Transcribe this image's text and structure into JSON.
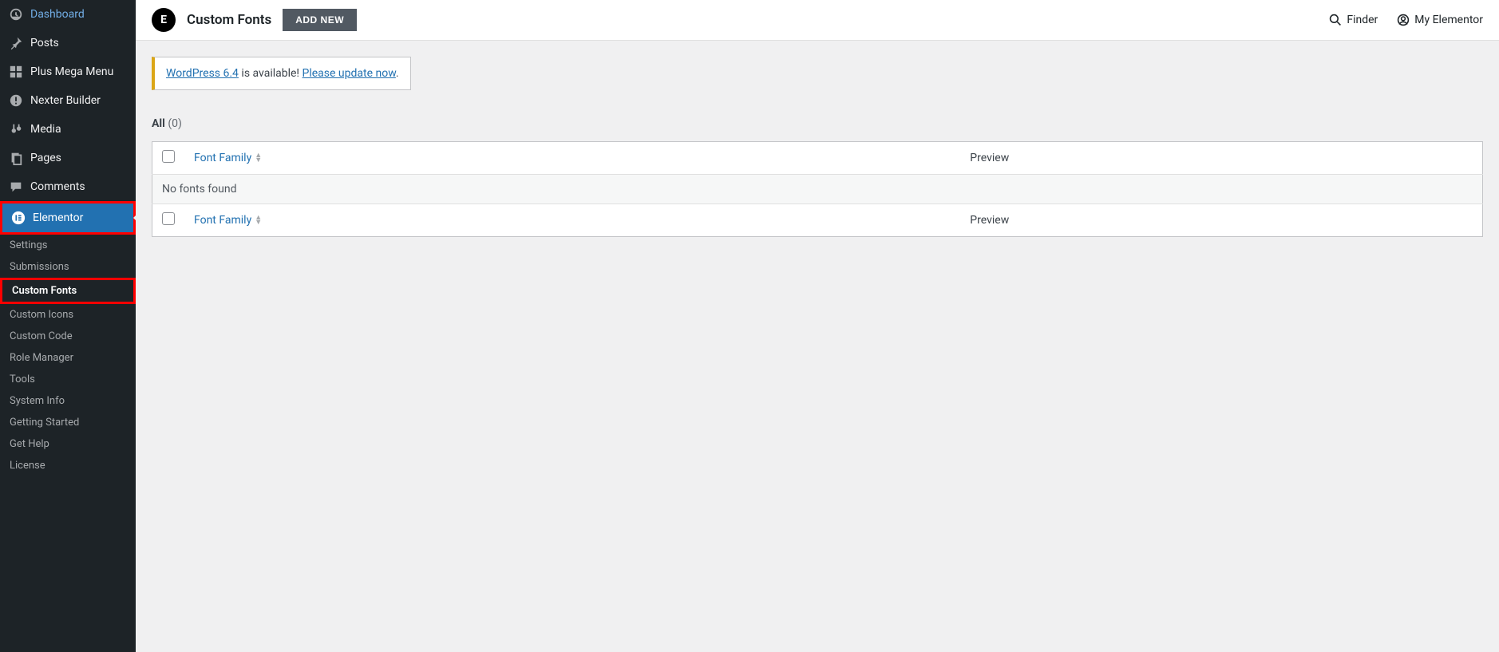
{
  "sidebar": {
    "items": [
      {
        "label": "Dashboard"
      },
      {
        "label": "Posts"
      },
      {
        "label": "Plus Mega Menu"
      },
      {
        "label": "Nexter Builder"
      },
      {
        "label": "Media"
      },
      {
        "label": "Pages"
      },
      {
        "label": "Comments"
      },
      {
        "label": "Elementor"
      }
    ],
    "submenu": [
      {
        "label": "Settings"
      },
      {
        "label": "Submissions"
      },
      {
        "label": "Custom Fonts"
      },
      {
        "label": "Custom Icons"
      },
      {
        "label": "Custom Code"
      },
      {
        "label": "Role Manager"
      },
      {
        "label": "Tools"
      },
      {
        "label": "System Info"
      },
      {
        "label": "Getting Started"
      },
      {
        "label": "Get Help"
      },
      {
        "label": "License"
      }
    ]
  },
  "header": {
    "logo_text": "E",
    "title": "Custom Fonts",
    "add_new": "ADD NEW",
    "finder": "Finder",
    "my_elementor": "My Elementor"
  },
  "notice": {
    "version_link": "WordPress 6.4",
    "middle": " is available! ",
    "update_link": "Please update now",
    "end": "."
  },
  "filters": {
    "all_label": "All",
    "all_count": "(0)"
  },
  "table": {
    "col_font": "Font Family",
    "col_preview": "Preview",
    "empty": "No fonts found"
  }
}
